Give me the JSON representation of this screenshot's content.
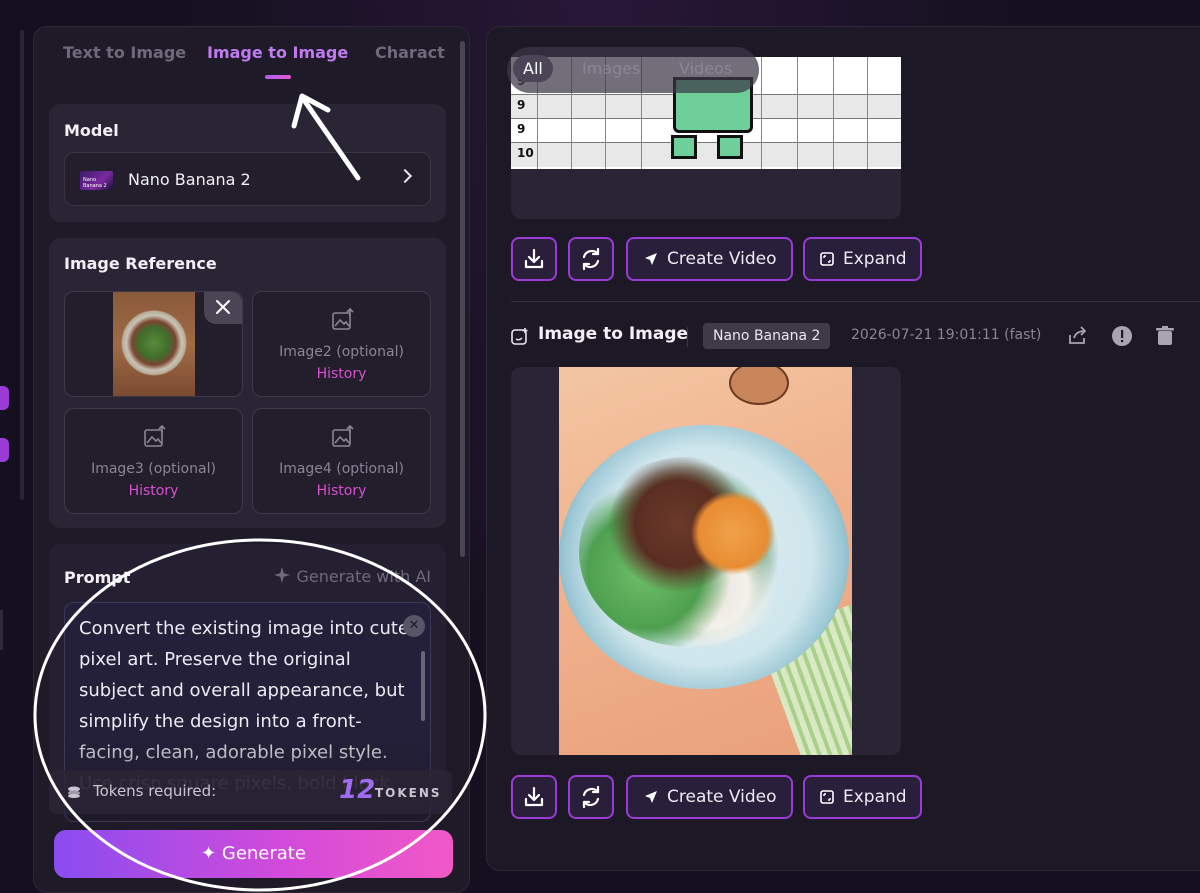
{
  "tabs": [
    {
      "label": "Text to Image",
      "active": false
    },
    {
      "label": "Image to Image",
      "active": true
    },
    {
      "label": "Charact",
      "active": false
    }
  ],
  "model": {
    "title": "Model",
    "thumb_text": "Nano Banana 2",
    "selected": "Nano Banana 2"
  },
  "image_reference": {
    "title": "Image Reference",
    "slots": [
      {
        "label": "Image2 (optional)",
        "history": "History"
      },
      {
        "label": "Image3 (optional)",
        "history": "History"
      },
      {
        "label": "Image4 (optional)",
        "history": "History"
      }
    ]
  },
  "prompt": {
    "title": "Prompt",
    "ai_label": "Generate with AI",
    "text": "Convert the existing image into cute pixel art. Preserve the original subject and overall appearance, but simplify the design into a front-facing, clean, adorable pixel style. Use crisp square pixels, bold black"
  },
  "tokens": {
    "label": "Tokens required:",
    "count": "12",
    "unit": "TOKENS"
  },
  "generate": {
    "label": "Generate"
  },
  "filter": {
    "options": [
      "All",
      "Images",
      "Videos"
    ],
    "active": "All"
  },
  "grid_rows": [
    "9",
    "9",
    "10"
  ],
  "actions": {
    "create_video": "Create Video",
    "expand": "Expand"
  },
  "result": {
    "title": "Image to Image",
    "model_badge": "Nano Banana 2",
    "timestamp": "2026-07-21 19:01:11 (fast)"
  },
  "colors": {
    "accent": "#9a3bd6",
    "active_tab": "#c07af0",
    "history_link": "#d94fd0",
    "generate_gradient_start": "#8a4cf0",
    "generate_gradient_end": "#f058c6"
  },
  "icons": [
    "download-icon",
    "regenerate-icon",
    "send-icon",
    "expand-icon",
    "share-icon",
    "info-icon",
    "trash-icon",
    "image-upload-icon",
    "close-icon",
    "sparkle-icon",
    "coins-icon",
    "chevron-right-icon",
    "image-edit-icon"
  ]
}
